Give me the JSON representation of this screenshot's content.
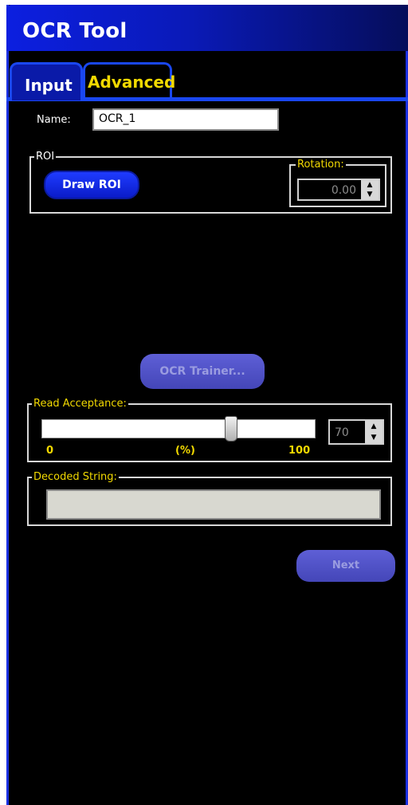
{
  "window": {
    "title": "OCR Tool"
  },
  "tabs": [
    {
      "label": "Input"
    },
    {
      "label": "Advanced"
    }
  ],
  "name_field": {
    "label": "Name:",
    "value": "OCR_1"
  },
  "roi": {
    "legend": "ROI",
    "draw_button": "Draw ROI",
    "rotation": {
      "legend": "Rotation:",
      "value": "0.00"
    }
  },
  "ocr_trainer_button": "OCR Trainer...",
  "read_acceptance": {
    "legend": "Read Acceptance:",
    "value": "70",
    "level": 70,
    "min_label": "0",
    "unit_label": "(%)",
    "max_label": "100"
  },
  "decoded_string": {
    "legend": "Decoded String:",
    "value": ""
  },
  "next_button": "Next",
  "colors": {
    "accent_blue": "#1a47f0",
    "title_blue": "#0c1fe0",
    "legend_yellow": "#f2d900"
  }
}
